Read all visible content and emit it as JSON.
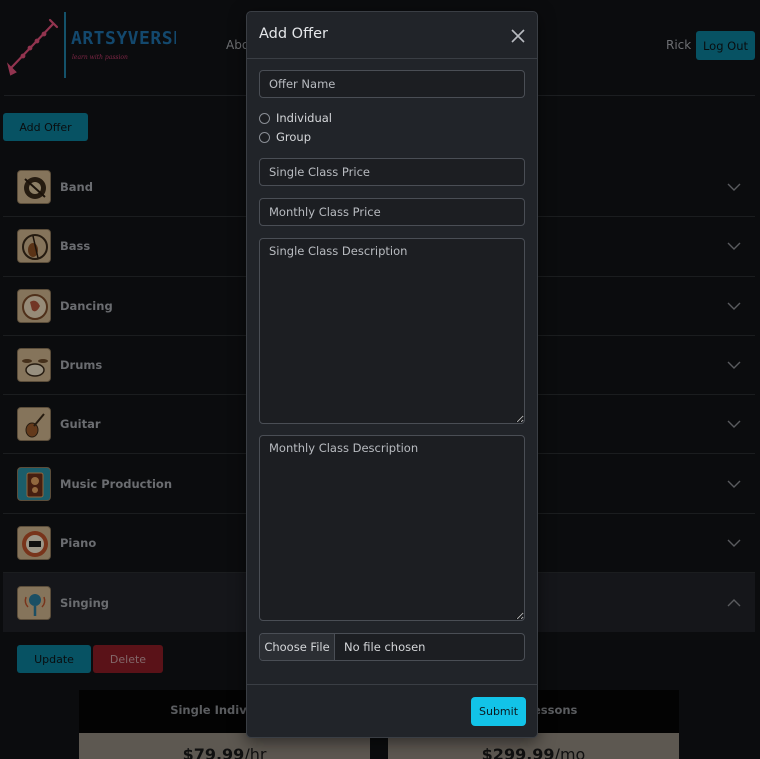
{
  "header": {
    "brand": "ARTSYVERSE",
    "tagline": "learn with passion",
    "nav_about": "Abo",
    "user_name": "Rick",
    "logout_label": "Log Out"
  },
  "toolbar": {
    "add_offer_label": "Add Offer"
  },
  "categories": [
    {
      "label": "Band",
      "icon": "band-icon"
    },
    {
      "label": "Bass",
      "icon": "bass-icon"
    },
    {
      "label": "Dancing",
      "icon": "dancing-icon"
    },
    {
      "label": "Drums",
      "icon": "drums-icon"
    },
    {
      "label": "Guitar",
      "icon": "guitar-icon"
    },
    {
      "label": "Music Production",
      "icon": "music-production-icon"
    },
    {
      "label": "Piano",
      "icon": "piano-icon"
    },
    {
      "label": "Singing",
      "icon": "singing-icon",
      "expanded": true
    }
  ],
  "expanded_section": {
    "update_label": "Update",
    "delete_label": "Delete",
    "cards": [
      {
        "title": "Single Individual",
        "price": "$79.99",
        "unit": "/hr"
      },
      {
        "title": "idual Lessons",
        "price": "$299.99",
        "unit": "/mo"
      }
    ]
  },
  "modal": {
    "title": "Add Offer",
    "offer_name_placeholder": "Offer Name",
    "type_options": [
      "Individual",
      "Group"
    ],
    "single_price_placeholder": "Single Class Price",
    "monthly_price_placeholder": "Monthly Class Price",
    "single_desc_placeholder": "Single Class Description",
    "monthly_desc_placeholder": "Monthly Class Description",
    "file_button_label": "Choose File",
    "file_status": "No file chosen",
    "submit_label": "Submit"
  },
  "colors": {
    "accent": "#0b7f99",
    "submit": "#12c3e8",
    "danger": "#8a1c25",
    "background": "#121316",
    "modal": "#212429"
  }
}
